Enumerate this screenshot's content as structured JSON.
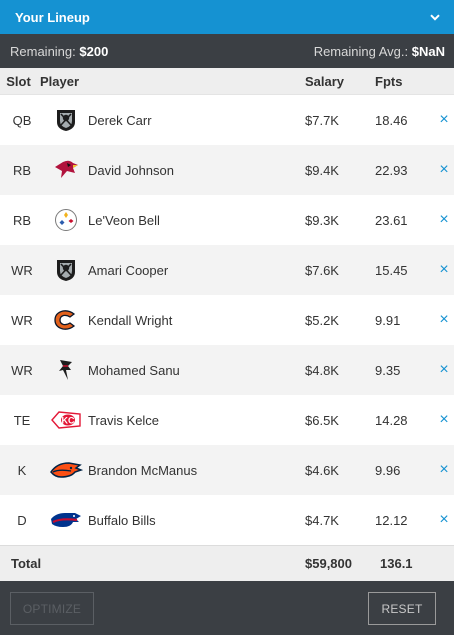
{
  "header": {
    "title": "Your Lineup",
    "toggle_icon": "chevron-down-icon"
  },
  "remaining": {
    "label": "Remaining:",
    "value": "$200",
    "avg_label": "Remaining Avg.:",
    "avg_value": "$NaN"
  },
  "columns": {
    "slot": "Slot",
    "player": "Player",
    "salary": "Salary",
    "fpts": "Fpts"
  },
  "rows": [
    {
      "slot": "QB",
      "team_logo": "raiders-logo",
      "player": "Derek Carr",
      "salary": "$7.7K",
      "fpts": "18.46",
      "remove": "×"
    },
    {
      "slot": "RB",
      "team_logo": "cardinals-logo",
      "player": "David Johnson",
      "salary": "$9.4K",
      "fpts": "22.93",
      "remove": "×"
    },
    {
      "slot": "RB",
      "team_logo": "steelers-logo",
      "player": "Le'Veon Bell",
      "salary": "$9.3K",
      "fpts": "23.61",
      "remove": "×"
    },
    {
      "slot": "WR",
      "team_logo": "raiders-logo",
      "player": "Amari Cooper",
      "salary": "$7.6K",
      "fpts": "15.45",
      "remove": "×"
    },
    {
      "slot": "WR",
      "team_logo": "bears-logo",
      "player": "Kendall Wright",
      "salary": "$5.2K",
      "fpts": "9.91",
      "remove": "×"
    },
    {
      "slot": "WR",
      "team_logo": "falcons-logo",
      "player": "Mohamed Sanu",
      "salary": "$4.8K",
      "fpts": "9.35",
      "remove": "×"
    },
    {
      "slot": "TE",
      "team_logo": "chiefs-logo",
      "player": "Travis Kelce",
      "salary": "$6.5K",
      "fpts": "14.28",
      "remove": "×"
    },
    {
      "slot": "K",
      "team_logo": "broncos-logo",
      "player": "Brandon McManus",
      "salary": "$4.6K",
      "fpts": "9.96",
      "remove": "×"
    },
    {
      "slot": "D",
      "team_logo": "bills-logo",
      "player": "Buffalo Bills",
      "salary": "$4.7K",
      "fpts": "12.12",
      "remove": "×"
    }
  ],
  "total": {
    "label": "Total",
    "salary": "$59,800",
    "fpts": "136.1"
  },
  "buttons": {
    "optimize": "OPTIMIZE",
    "reset": "RESET"
  },
  "colors": {
    "accent": "#1592d2",
    "dark": "#3b3f44"
  }
}
